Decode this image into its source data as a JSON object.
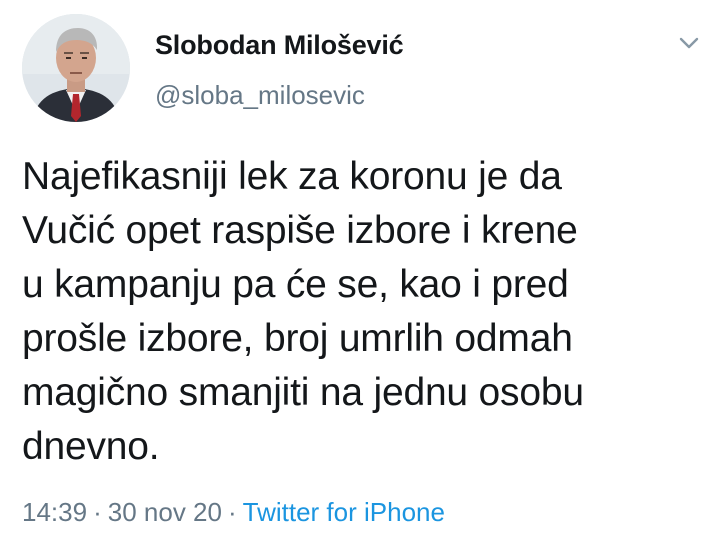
{
  "tweet": {
    "author": {
      "display_name": "Slobodan Milošević",
      "handle": "@sloba_milosevic",
      "avatar_icon": "profile-photo"
    },
    "menu_icon": "chevron-down-icon",
    "text": "Najefikasniji lek za koronu je da\nVučić opet raspiše izbore i krene\nu kampanju pa će se, kao i pred\nprošle izbore, broj umrlih odmah\nmagično smanjiti na jednu osobu\ndnevno.",
    "meta": {
      "time": "14:39",
      "separator": "·",
      "date": "30 nov 20",
      "source": "Twitter for iPhone"
    },
    "colors": {
      "text": "#14171a",
      "secondary": "#657786",
      "link": "#1b95e0",
      "background": "#ffffff"
    }
  }
}
